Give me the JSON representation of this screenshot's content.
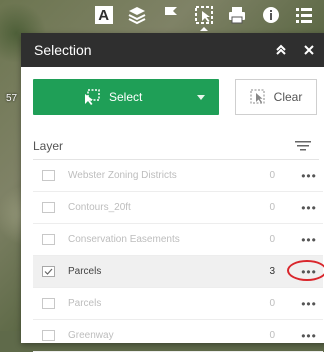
{
  "map": {
    "edge_label": "57"
  },
  "toolbar": {
    "tools": [
      {
        "icon": "basemap-letter-icon",
        "glyph": "A"
      },
      {
        "icon": "layers-icon"
      },
      {
        "icon": "legend-icon"
      },
      {
        "icon": "selection-icon"
      },
      {
        "icon": "print-icon"
      },
      {
        "icon": "info-icon"
      },
      {
        "icon": "list-icon"
      }
    ]
  },
  "panel": {
    "title": "Selection",
    "select_label": "Select",
    "clear_label": "Clear",
    "layer_header": "Layer",
    "rows": [
      {
        "name": "Webster Zoning Districts",
        "count": "0",
        "checked": false
      },
      {
        "name": "Contours_20ft",
        "count": "0",
        "checked": false
      },
      {
        "name": "Conservation Easements",
        "count": "0",
        "checked": false
      },
      {
        "name": "Parcels",
        "count": "3",
        "checked": true
      },
      {
        "name": "Parcels",
        "count": "0",
        "checked": false
      },
      {
        "name": "Greenway",
        "count": "0",
        "checked": false
      }
    ],
    "more_glyph": "•••"
  },
  "colors": {
    "header_bg": "#2f2f2f",
    "select_green": "#1f9f57",
    "highlight_red": "#d9262c"
  }
}
